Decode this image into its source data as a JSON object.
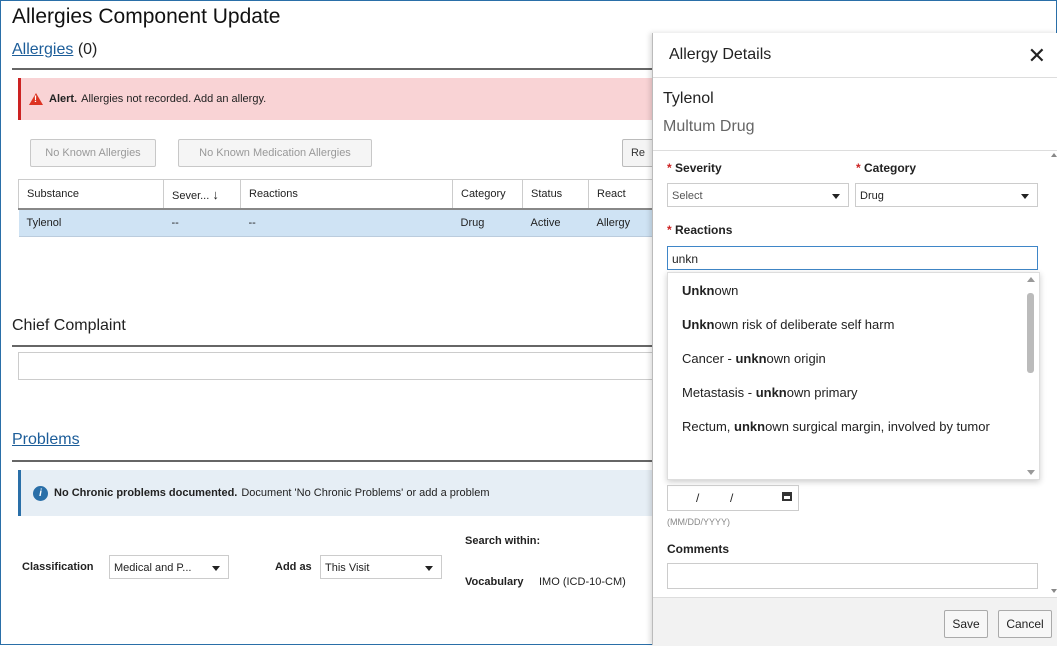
{
  "page": {
    "title": "Allergies Component Update"
  },
  "allergies": {
    "link": "Allergies",
    "count": "(0)",
    "alert_bold": "Alert.",
    "alert_text": "Allergies not recorded. Add an allergy.",
    "btn_nka": "No Known Allergies",
    "btn_nkma": "No Known Medication Allergies",
    "btn_partial": "Re",
    "columns": [
      "Substance",
      "Sever...",
      "Reactions",
      "Category",
      "Status",
      "React"
    ],
    "sort_icon": "arrow-down-icon",
    "rows": [
      [
        "Tylenol",
        "--",
        "--",
        "Drug",
        "Active",
        "Allergy"
      ]
    ]
  },
  "chief_complaint": {
    "title": "Chief Complaint",
    "value": ""
  },
  "problems": {
    "link": "Problems",
    "info_bold": "No Chronic problems documented.",
    "info_text": "Document 'No Chronic Problems' or add a problem",
    "classification_label": "Classification",
    "classification_value": "Medical and P...",
    "add_as_label": "Add as",
    "add_as_value": "This Visit",
    "search_within": "Search within:",
    "vocabulary_label": "Vocabulary",
    "vocabulary_value": "IMO (ICD-10-CM)"
  },
  "panel": {
    "title": "Allergy Details",
    "close_icon": "close-icon",
    "drug_name": "Tylenol",
    "drug_type": "Multum Drug",
    "required_marker": "*",
    "severity_label": "Severity",
    "severity_value": "Select",
    "category_label": "Category",
    "category_value": "Drug",
    "reactions_label": "Reactions",
    "reactions_query": "unkn",
    "suggestions": [
      {
        "pre": "",
        "match": "Unkn",
        "post": "own"
      },
      {
        "pre": "",
        "match": "Unkn",
        "post": "own risk of deliberate self harm"
      },
      {
        "pre": "Cancer - ",
        "match": "unkn",
        "post": "own origin"
      },
      {
        "pre": "Metastasis - ",
        "match": "unkn",
        "post": "own primary"
      },
      {
        "pre": "Rectum, ",
        "match": "unkn",
        "post": "own surgical margin, involved by tumor"
      }
    ],
    "date_slash": "/",
    "date_hint": "(MM/DD/YYYY)",
    "calendar_icon": "calendar-icon",
    "comments_label": "Comments",
    "comments_value": "",
    "save_label": "Save",
    "cancel_label": "Cancel"
  },
  "colors": {
    "link": "#1c5d99",
    "alert_bg": "#f9d3d5",
    "selected_row": "#cfe3f4",
    "info_bg": "#e6eef5",
    "required": "#cc2222"
  }
}
